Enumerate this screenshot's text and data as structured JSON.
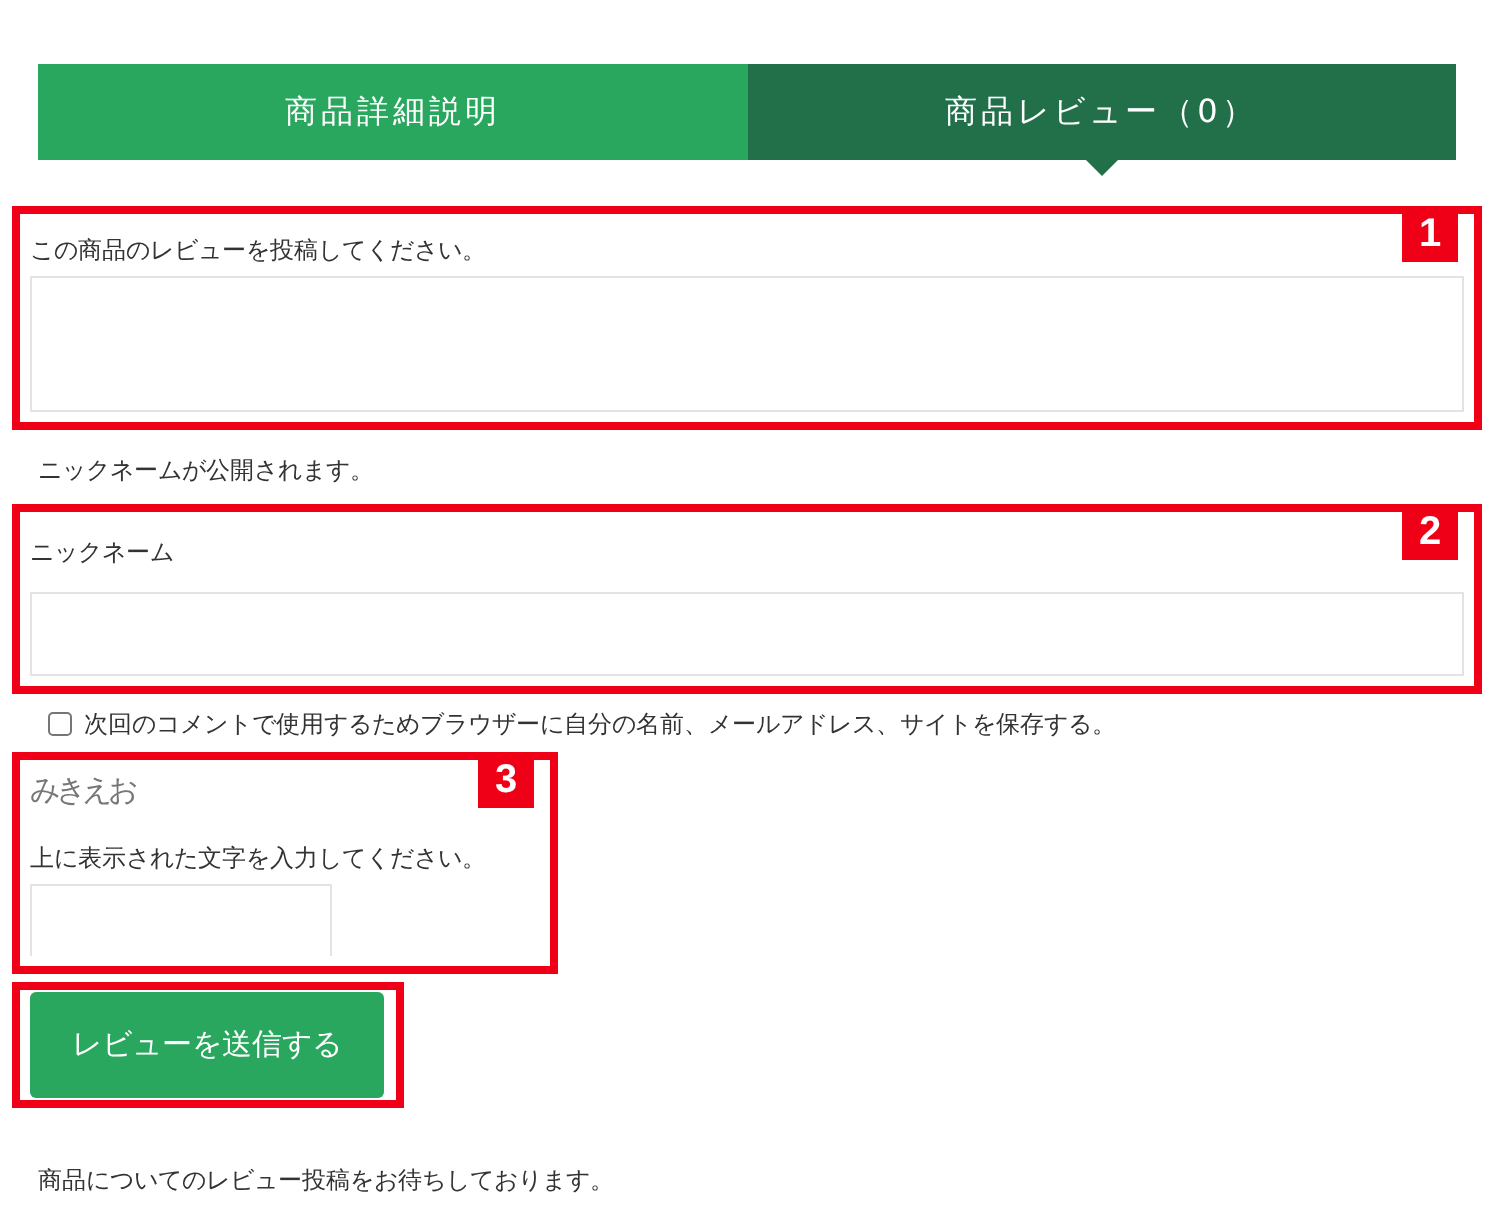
{
  "tabs": [
    {
      "label": "商品詳細説明",
      "selected": false
    },
    {
      "label": "商品レビュー（0）",
      "selected": true
    }
  ],
  "review_field": {
    "label": "この商品のレビューを投稿してください。",
    "annotation": "1"
  },
  "nickname_note": "ニックネームが公開されます。",
  "nickname_field": {
    "label": "ニックネーム",
    "annotation": "2"
  },
  "save_info": {
    "label": "次回のコメントで使用するためブラウザーに自分の名前、メールアドレス、サイトを保存する。",
    "checked": false
  },
  "captcha": {
    "text": "みきえお",
    "label": "上に表示された文字を入力してください。",
    "annotation": "3"
  },
  "submit_button": "レビューを送信する",
  "footer_text": "商品についてのレビュー投稿をお待ちしております。"
}
